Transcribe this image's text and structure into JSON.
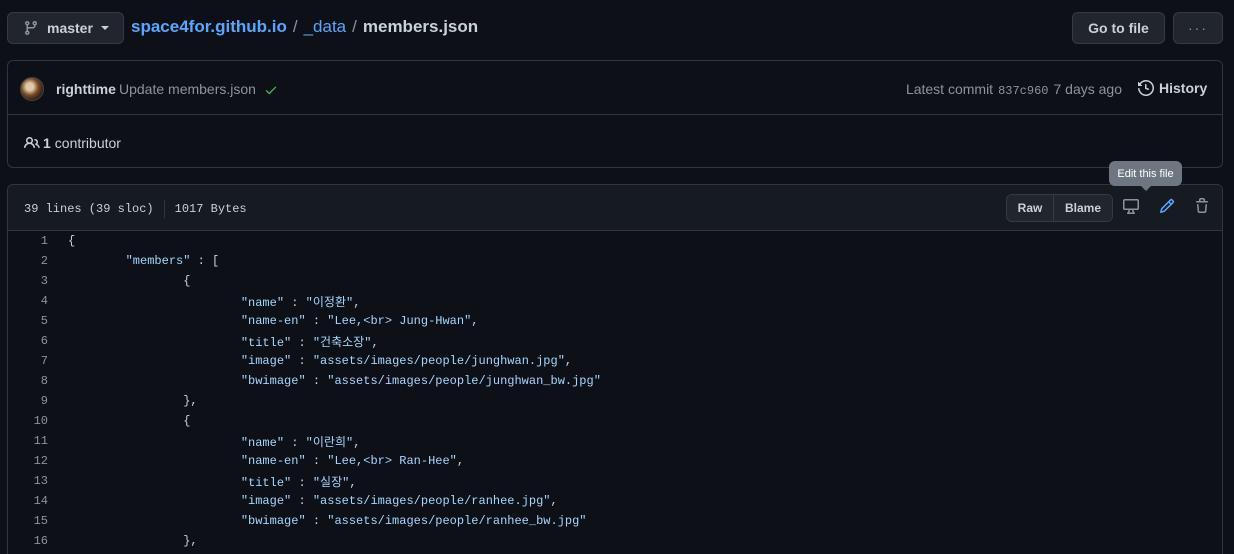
{
  "branch": {
    "label": "master",
    "icon": "git-branch-icon"
  },
  "breadcrumb": {
    "repo": "space4for.github.io",
    "sep1": "/",
    "folder": "_data",
    "sep2": "/",
    "file": "members.json"
  },
  "toolbar": {
    "goto_label": "Go to file",
    "more_label": "···"
  },
  "commit": {
    "author": "righttime",
    "message": "Update members.json",
    "latest_label": "Latest commit",
    "sha": "837c960",
    "time": "7 days ago",
    "history_label": "History",
    "status_color": "#3fb950"
  },
  "contributors": {
    "count": "1",
    "label": "contributor"
  },
  "file": {
    "lines_info": "39 lines (39 sloc)",
    "size": "1017 Bytes",
    "raw_label": "Raw",
    "blame_label": "Blame",
    "edit_tooltip": "Edit this file"
  },
  "code_lines": [
    "{",
    "        \"members\" : [",
    "                {",
    "                        \"name\" : \"이정환\",",
    "                        \"name-en\" : \"Lee,<br> Jung-Hwan\",",
    "                        \"title\" : \"건축소장\",",
    "                        \"image\" : \"assets/images/people/junghwan.jpg\",",
    "                        \"bwimage\" : \"assets/images/people/junghwan_bw.jpg\"",
    "                },",
    "                {",
    "                        \"name\" : \"이란희\",",
    "                        \"name-en\" : \"Lee,<br> Ran-Hee\",",
    "                        \"title\" : \"실장\",",
    "                        \"image\" : \"assets/images/people/ranhee.jpg\",",
    "                        \"bwimage\" : \"assets/images/people/ranhee_bw.jpg\"",
    "                },"
  ],
  "colors": {
    "accent": "#58a6ff",
    "background": "#0d1117",
    "string": "#a5d6ff"
  }
}
